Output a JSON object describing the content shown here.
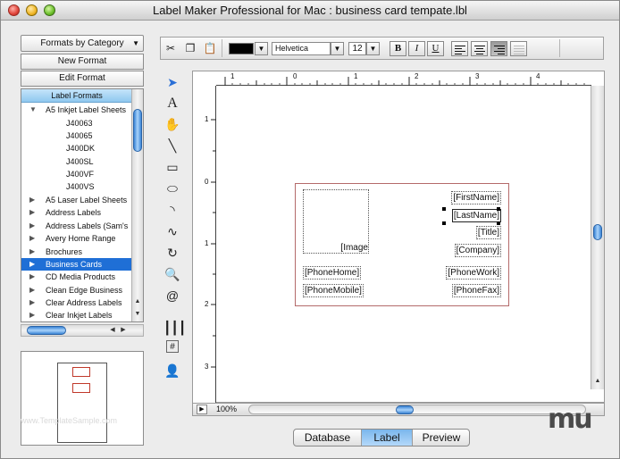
{
  "window": {
    "title": "Label Maker Professional for Mac : business card tempate.lbl"
  },
  "left_panel": {
    "formats_dropdown": "Formats by Category",
    "new_format": "New Format",
    "edit_format": "Edit Format",
    "tree_header": "Label Formats",
    "tree": [
      {
        "label": "A5 Inkjet Label Sheets",
        "level": 0,
        "expanded": true
      },
      {
        "label": "J40063",
        "level": 1
      },
      {
        "label": "J40065",
        "level": 1
      },
      {
        "label": "J400DK",
        "level": 1
      },
      {
        "label": "J400SL",
        "level": 1
      },
      {
        "label": "J400VF",
        "level": 1
      },
      {
        "label": "J400VS",
        "level": 1
      },
      {
        "label": "A5 Laser Label Sheets",
        "level": 0
      },
      {
        "label": "Address Labels",
        "level": 0
      },
      {
        "label": "Address Labels (Sam's",
        "level": 0
      },
      {
        "label": "Avery Home Range",
        "level": 0
      },
      {
        "label": "Brochures",
        "level": 0
      },
      {
        "label": "Business Cards",
        "level": 0,
        "selected": true
      },
      {
        "label": "CD Media Products",
        "level": 0
      },
      {
        "label": "Clean Edge  Business",
        "level": 0
      },
      {
        "label": "Clear Address Labels",
        "level": 0
      },
      {
        "label": "Clear Inkjet Labels",
        "level": 0
      }
    ]
  },
  "toolbar": {
    "font": "Helvetica",
    "size": "12",
    "bold": "B",
    "italic": "I",
    "underline": "U"
  },
  "ruler": {
    "h_labels": [
      "1",
      "0",
      "1",
      "2",
      "3",
      "4"
    ],
    "v_labels": [
      "1",
      "0",
      "1",
      "2",
      "3"
    ]
  },
  "card": {
    "image": "[Image",
    "first_name": "[FirstName]",
    "last_name": "[LastName]",
    "title": "[Title]",
    "company": "[Company]",
    "phone_home": "[PhoneHome]",
    "phone_work": "[PhoneWork]",
    "phone_mobile": "[PhoneMobile]",
    "phone_fax": "[PhoneFax]"
  },
  "bottom": {
    "zoom": "100%"
  },
  "tabs": [
    "Database",
    "Label",
    "Preview"
  ],
  "active_tab": "Label",
  "logo": "mu",
  "watermark": "www.TemplateSample.com"
}
